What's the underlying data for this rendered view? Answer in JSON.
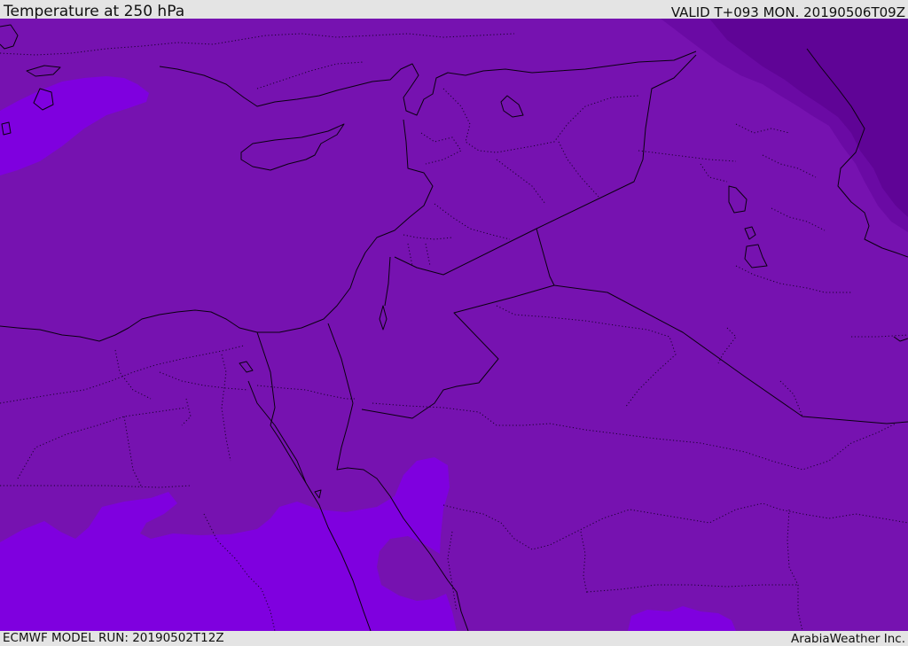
{
  "header": {
    "title": "Temperature at 250 hPa",
    "valid": "VALID T+093 MON. 20190506T09Z"
  },
  "footer": {
    "model_run": "ECMWF MODEL RUN: 20190502T12Z",
    "credit": "ArabiaWeather Inc."
  },
  "map": {
    "field": "Temperature at 250 hPa",
    "colors": {
      "base": "#7612b0",
      "cold": "#5f0496",
      "colder": "#6a0aa4",
      "warm": "#7f00df",
      "warm_bright": "#8000e0",
      "coast": "#000000"
    }
  }
}
